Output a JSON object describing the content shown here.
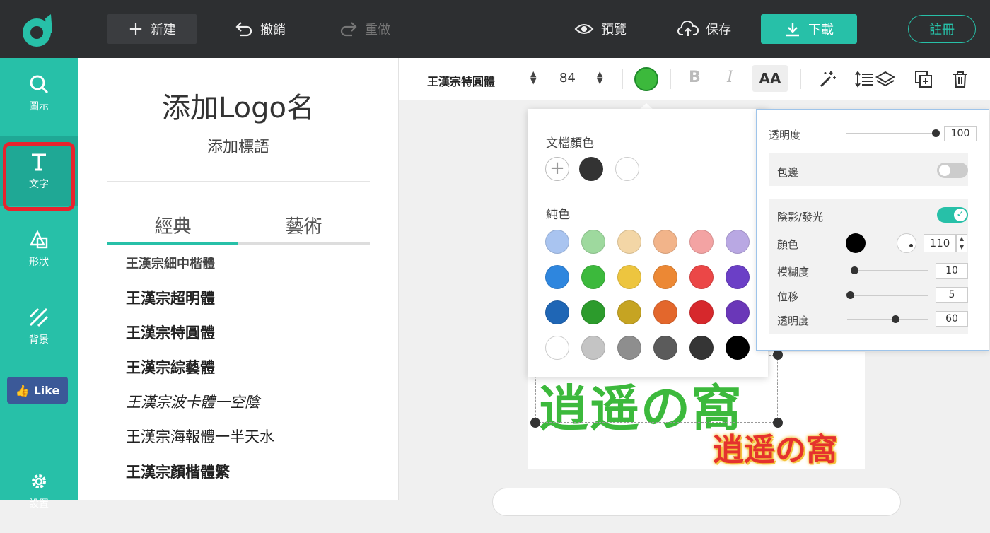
{
  "topbar": {
    "new_label": "新建",
    "undo_label": "撤銷",
    "redo_label": "重做",
    "preview_label": "預覽",
    "save_label": "保存",
    "download_label": "下載",
    "register_label": "註冊"
  },
  "sidenav": {
    "items": [
      {
        "label": "圖示",
        "icon": "search-icon"
      },
      {
        "label": "文字",
        "icon": "text-icon"
      },
      {
        "label": "形狀",
        "icon": "shapes-icon"
      },
      {
        "label": "背景",
        "icon": "background-icon"
      },
      {
        "label": "設置",
        "icon": "gear-icon"
      }
    ],
    "like_label": "Like"
  },
  "panel": {
    "title": "添加Logo名",
    "subtitle": "添加標語",
    "tabs": [
      "經典",
      "藝術"
    ],
    "fonts": [
      "王漢宗細中楷體",
      "王漢宗超明體",
      "王漢宗特圓體",
      "王漢宗綜藝體",
      "王漢宗波卡體一空陰",
      "王漢宗海報體一半天水",
      "王漢宗顏楷體繁"
    ]
  },
  "format_bar": {
    "font_name": "王漢宗特圓體",
    "font_size": "84",
    "current_color": "#3cb93c",
    "bold_label": "B",
    "italic_label": "I",
    "case_label": "AA"
  },
  "color_popup": {
    "doc_colors_label": "文檔顏色",
    "doc_colors": [
      "#333333",
      "#ffffff"
    ],
    "solid_label": "純色",
    "solid_colors": [
      [
        "#a9c4f0",
        "#9ed99e",
        "#f3d6a6",
        "#f2b48a",
        "#f3a3a3",
        "#b9a8e3"
      ],
      [
        "#2e86de",
        "#3cb93c",
        "#edc53f",
        "#ec8834",
        "#eb4747",
        "#6b3fc6"
      ],
      [
        "#1f66b5",
        "#2c9b2c",
        "#c6a422",
        "#e3672c",
        "#d6282c",
        "#6a37b8"
      ],
      [
        "#ffffff",
        "#c4c4c4",
        "#8e8e8e",
        "#5b5b5b",
        "#353535",
        "#000000"
      ]
    ]
  },
  "effects_panel": {
    "opacity_label": "透明度",
    "opacity_value": "100",
    "outline_label": "包邊",
    "shadow_label": "陰影/發光",
    "shadow_color_label": "顏色",
    "shadow_color": "#000000",
    "shadow_angle_value": "110",
    "blur_label": "模糊度",
    "blur_value": "10",
    "offset_label": "位移",
    "offset_value": "5",
    "shadow_opacity_label": "透明度",
    "shadow_opacity_value": "60"
  },
  "canvas": {
    "main_text": "逍遥の窩",
    "tagline_text": "逍遥の窩"
  }
}
